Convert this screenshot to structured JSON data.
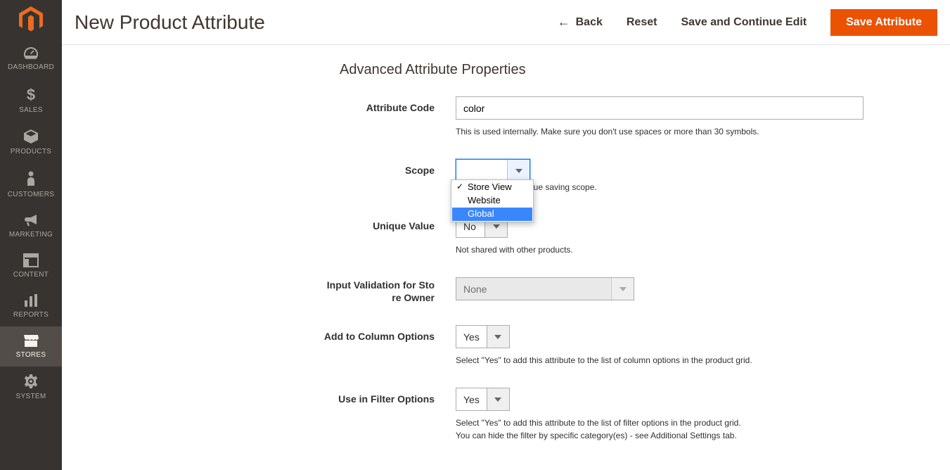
{
  "header": {
    "title": "New Product Attribute",
    "back_label": "Back",
    "reset_label": "Reset",
    "save_continue_label": "Save and Continue Edit",
    "save_label": "Save Attribute"
  },
  "sidebar": {
    "items": [
      {
        "label": "DASHBOARD",
        "icon": "gauge"
      },
      {
        "label": "SALES",
        "icon": "dollar"
      },
      {
        "label": "PRODUCTS",
        "icon": "cube"
      },
      {
        "label": "CUSTOMERS",
        "icon": "person"
      },
      {
        "label": "MARKETING",
        "icon": "megaphone"
      },
      {
        "label": "CONTENT",
        "icon": "layout"
      },
      {
        "label": "REPORTS",
        "icon": "bars"
      },
      {
        "label": "STORES",
        "icon": "store",
        "active": true
      },
      {
        "label": "SYSTEM",
        "icon": "gear"
      }
    ]
  },
  "section": {
    "title": "Advanced Attribute Properties"
  },
  "fields": {
    "attribute_code": {
      "label": "Attribute Code",
      "value": "color",
      "help": "This is used internally. Make sure you don't use spaces or more than 30 symbols."
    },
    "scope": {
      "label": "Scope",
      "value": "Store View",
      "help": "lue saving scope.",
      "options": [
        "Store View",
        "Website",
        "Global"
      ],
      "highlighted": "Global",
      "checked": "Store View"
    },
    "unique_value": {
      "label": "Unique Value",
      "value": "No",
      "help": "Not shared with other products."
    },
    "input_validation": {
      "label": "Input Validation for Store Owner",
      "value": "None"
    },
    "add_column": {
      "label": "Add to Column Options",
      "value": "Yes",
      "help": "Select \"Yes\" to add this attribute to the list of column options in the product grid."
    },
    "use_filter": {
      "label": "Use in Filter Options",
      "value": "Yes",
      "help1": "Select \"Yes\" to add this attribute to the list of filter options in the product grid.",
      "help2": "You can hide the filter by specific category(es) - see Additional Settings tab."
    }
  }
}
